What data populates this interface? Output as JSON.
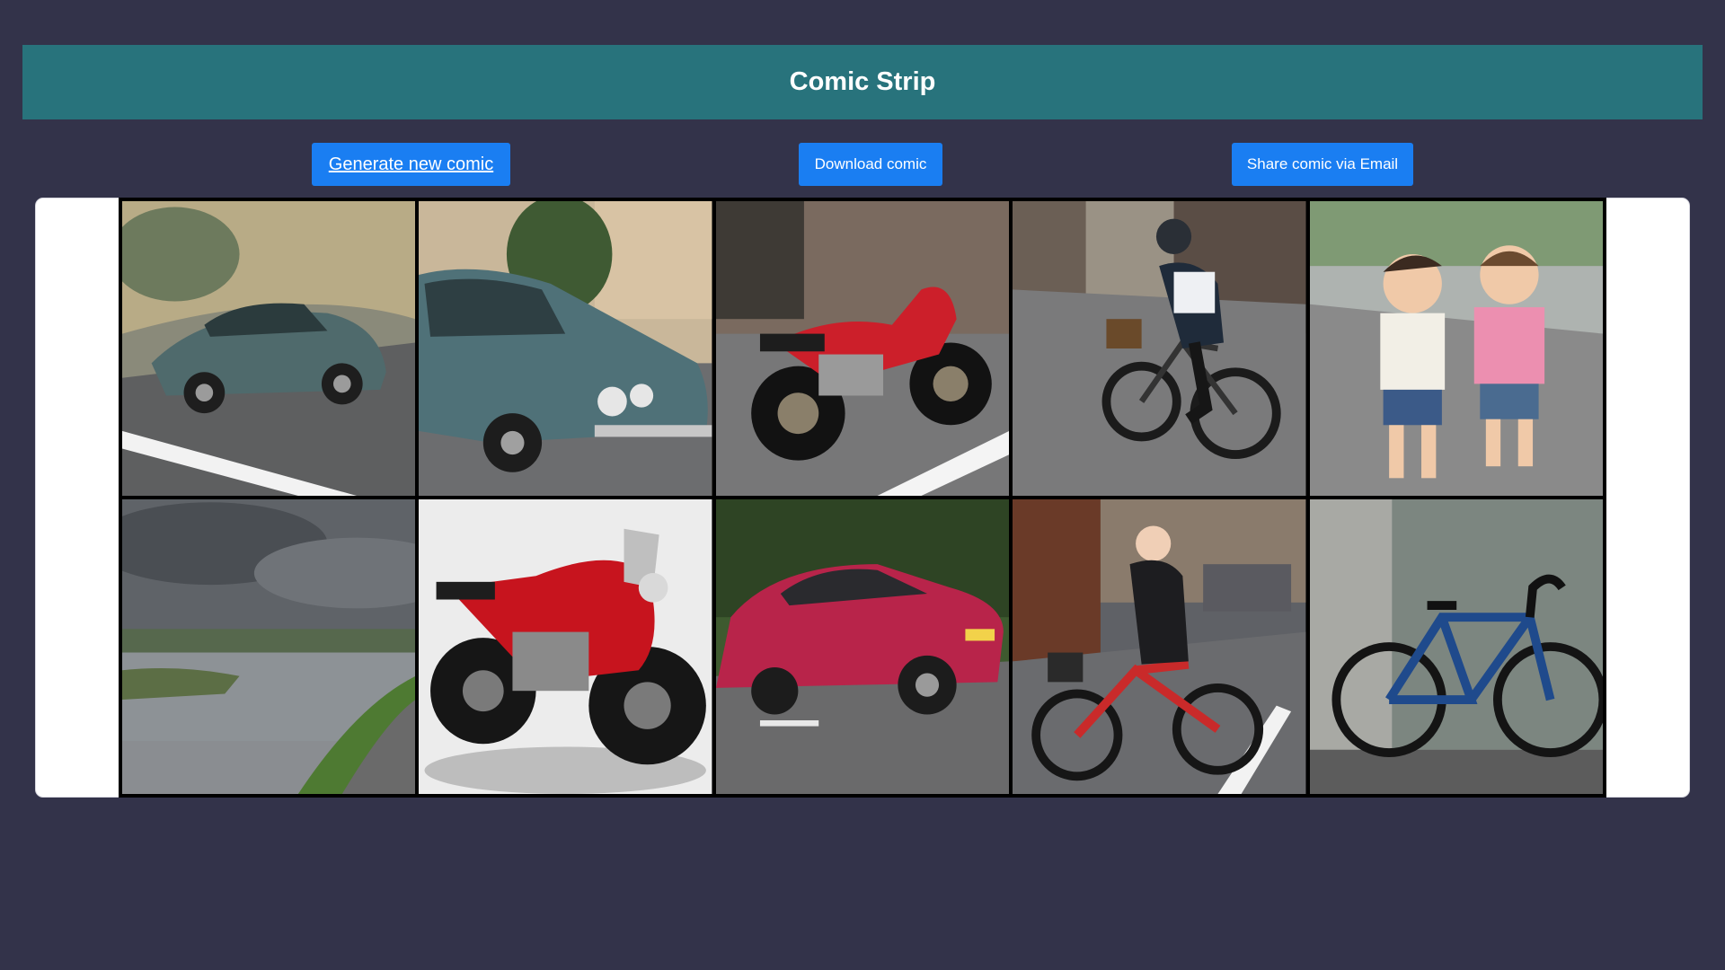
{
  "header": {
    "title": "Comic Strip"
  },
  "actions": {
    "generate_label": "Generate new comic",
    "download_label": "Download comic",
    "share_label": "Share comic via Email"
  },
  "panels": [
    {
      "subject": "teal vintage sedan driving on countryside road"
    },
    {
      "subject": "teal vintage car parked on street"
    },
    {
      "subject": "red motorcycle on city street"
    },
    {
      "subject": "cyclist with helmet riding bike with basket"
    },
    {
      "subject": "two laughing children running"
    },
    {
      "subject": "river under cloudy sky with path"
    },
    {
      "subject": "red sport motorcycle studio shot"
    },
    {
      "subject": "red sedan driving past forest"
    },
    {
      "subject": "woman cyclist riding red bicycle"
    },
    {
      "subject": "blue road bicycle leaning on wall"
    }
  ],
  "colors": {
    "background": "#33334a",
    "header": "#28737c",
    "button": "#1a7ef2"
  }
}
